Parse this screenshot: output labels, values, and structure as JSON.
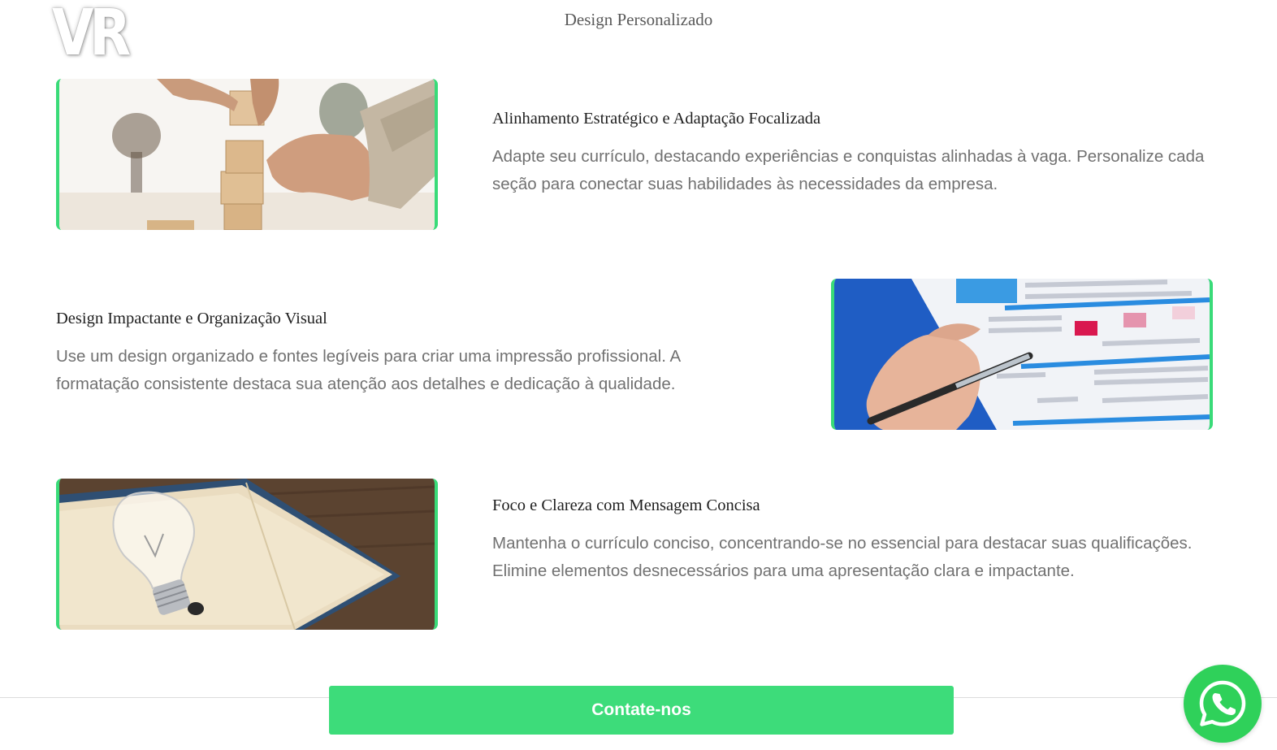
{
  "brand": {
    "logo_text": "VR"
  },
  "header": {
    "title": "Design Personalizado"
  },
  "features": [
    {
      "title": "Alinhamento Estratégico e Adaptação Focalizada",
      "description": "Adapte seu currículo, destacando experiências e conquistas alinhadas à vaga. Personalize cada seção para conectar suas habilidades às necessidades da empresa.",
      "image_subject": "hands stacking wooden blocks"
    },
    {
      "title": "Design Impactante e Organização Visual",
      "description": "Use um design organizado e fontes legíveis para criar uma impressão profissional. A formatação consistente destaca sua atenção aos detalhes e dedicação à qualidade.",
      "image_subject": "hand with pen over printed report"
    },
    {
      "title": "Foco e Clareza com Mensagem Concisa",
      "description": "Mantenha o currículo conciso, concentrando-se no essencial para destacar suas qualificações. Elimine elementos desnecessários para uma apresentação clara e impactante.",
      "image_subject": "light bulb on open book"
    }
  ],
  "cta": {
    "label": "Contate-nos"
  },
  "floating": {
    "icon": "whatsapp-icon"
  },
  "colors": {
    "accent": "#3ddc7a",
    "whatsapp": "#2fd15a",
    "heading": "#1e1e1e",
    "body_text": "#717171"
  }
}
